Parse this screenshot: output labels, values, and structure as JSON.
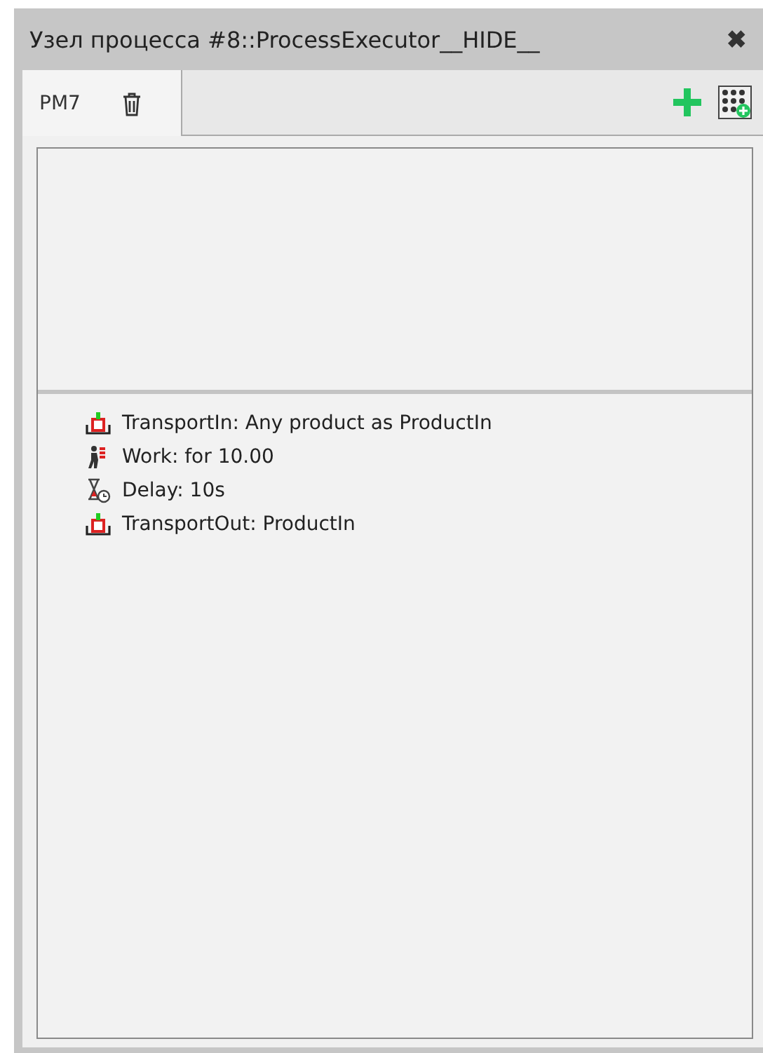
{
  "window": {
    "title": "Узел процесса #8::ProcessExecutor__HIDE__",
    "close": "✖"
  },
  "tabs": [
    {
      "label": "PM7",
      "selected": true
    }
  ],
  "steps": [
    {
      "kind": "transport",
      "text": "TransportIn: Any product as ProductIn"
    },
    {
      "kind": "work",
      "text": "Work: for 10.00"
    },
    {
      "kind": "delay",
      "text": "Delay: 10s"
    },
    {
      "kind": "transport",
      "text": "TransportOut: ProductIn"
    }
  ]
}
